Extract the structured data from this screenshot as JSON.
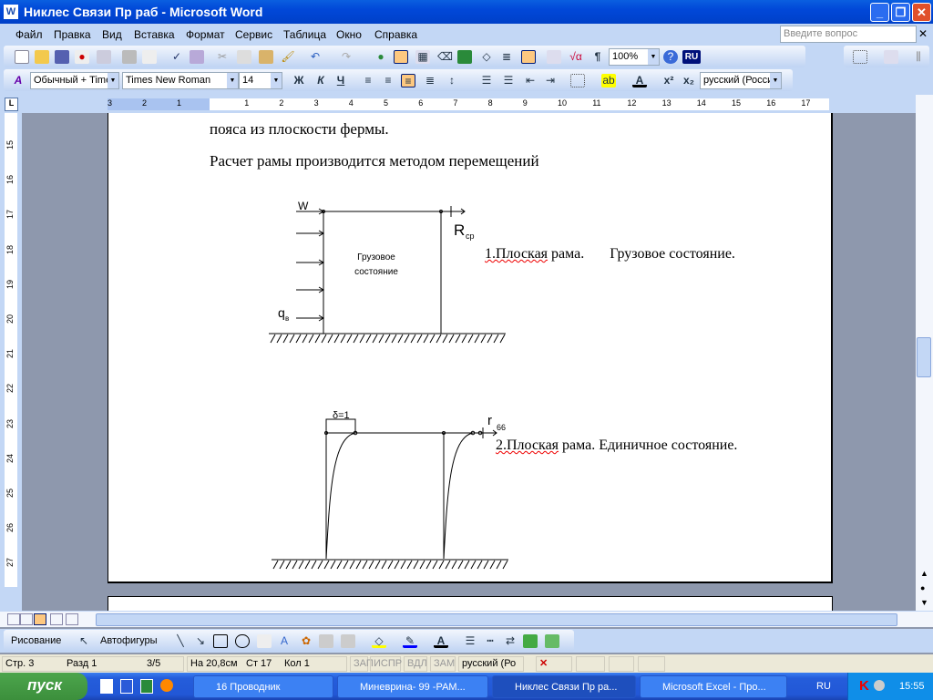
{
  "window": {
    "title": "Никлес Связи Пр раб - Microsoft Word",
    "min": "_",
    "max": "❐",
    "close": "✕"
  },
  "menu": [
    "Файл",
    "Правка",
    "Вид",
    "Вставка",
    "Формат",
    "Сервис",
    "Таблица",
    "Окно",
    "Справка"
  ],
  "help": {
    "placeholder": "Введите вопрос",
    "close": "✕"
  },
  "standard": {
    "zoom": "100%",
    "lang_badge": "RU"
  },
  "formatting": {
    "style": "Обычный + Time",
    "font": "Times New Roman",
    "size": "14",
    "bold": "Ж",
    "italic": "К",
    "underline": "Ч",
    "language": "русский (Росси"
  },
  "ruler": {
    "h_labels": [
      "3",
      "2",
      "1",
      "1",
      "2",
      "3",
      "4",
      "5",
      "6",
      "7",
      "8",
      "9",
      "10",
      "11",
      "12",
      "13",
      "14",
      "15",
      "16",
      "17"
    ],
    "v_labels": [
      "15",
      "16",
      "17",
      "18",
      "19",
      "20",
      "21",
      "22",
      "23",
      "24",
      "25",
      "26",
      "27"
    ]
  },
  "document": {
    "line1": "пояса из плоскости фермы.",
    "line2": "Расчет рамы производится методом перемещений",
    "fig1": {
      "w": "W",
      "q": "q",
      "q_sub": "в",
      "r": "R",
      "r_sub": "ср",
      "inner1": "Грузовое",
      "inner2": "состояние"
    },
    "caption1_a": "1.Плоская",
    "caption1_b": " рама.       Грузовое состояние.",
    "fig2": {
      "delta": "δ=1",
      "r": "r",
      "r_sub": "66"
    },
    "caption2_a": "2.Плоская",
    "caption2_b": " рама. Единичное состояние."
  },
  "drawing": {
    "draw": "Рисование",
    "autoshapes": "Автофигуры"
  },
  "status": {
    "page": "Стр. 3",
    "section": "Разд 1",
    "pages": "3/5",
    "at": "На 20,8см",
    "line": "Ст 17",
    "col": "Кол 1",
    "rec": "ЗАП",
    "trk": "ИСПР",
    "ext": "ВДЛ",
    "ovr": "ЗАМ",
    "lang": "русский (Ро"
  },
  "taskbar": {
    "start": "пуск",
    "tasks": [
      "16 Проводник",
      "Миневрина- 99 -РАМ...",
      "Никлес Связи Пр ра...",
      "Microsoft Excel - Про..."
    ],
    "lang": "RU",
    "clock": "15:55"
  }
}
